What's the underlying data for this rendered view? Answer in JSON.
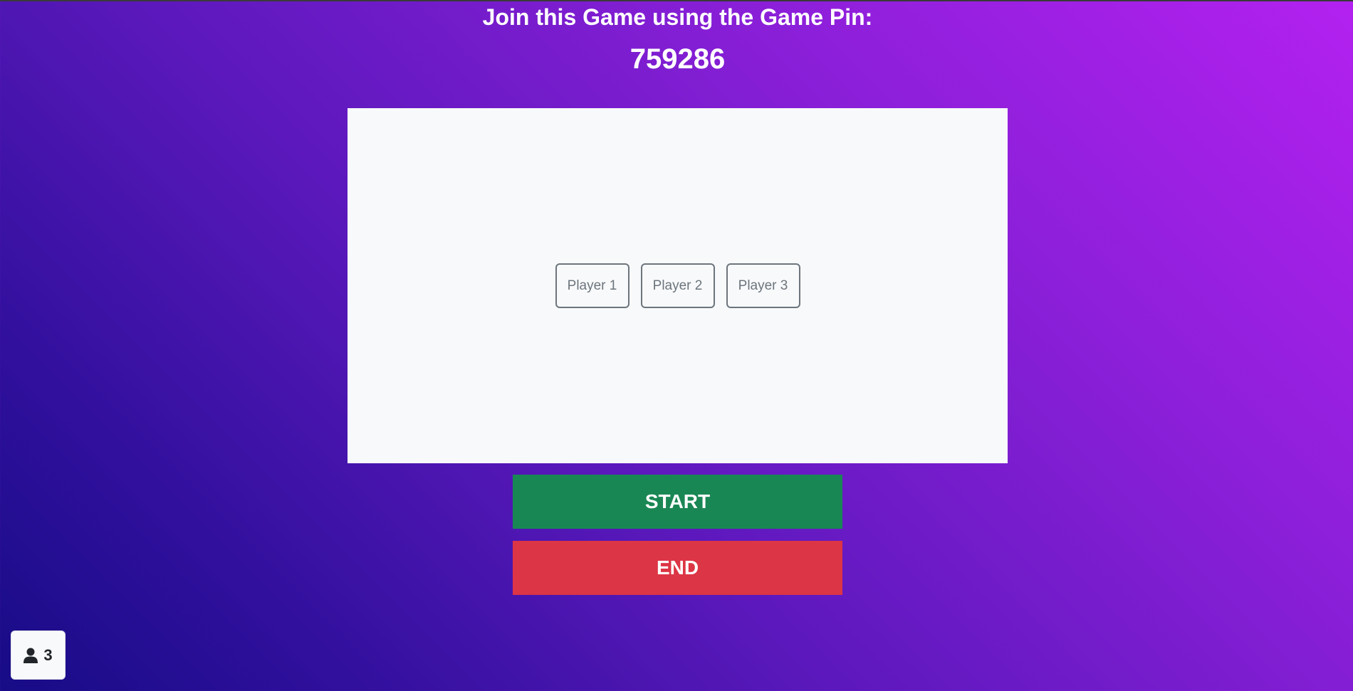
{
  "header": {
    "join_text": "Join this Game using the Game Pin:",
    "game_pin": "759286"
  },
  "lobby": {
    "players": [
      "Player 1",
      "Player 2",
      "Player 3"
    ]
  },
  "actions": {
    "start_label": "START",
    "end_label": "END"
  },
  "player_count": {
    "icon": "person-icon",
    "value": "3"
  },
  "colors": {
    "background_start": "#170c86",
    "background_end": "#b321f0",
    "panel": "#f8f9fa",
    "start": "#198754",
    "end": "#dc3545",
    "chip_border": "#6c757d"
  }
}
